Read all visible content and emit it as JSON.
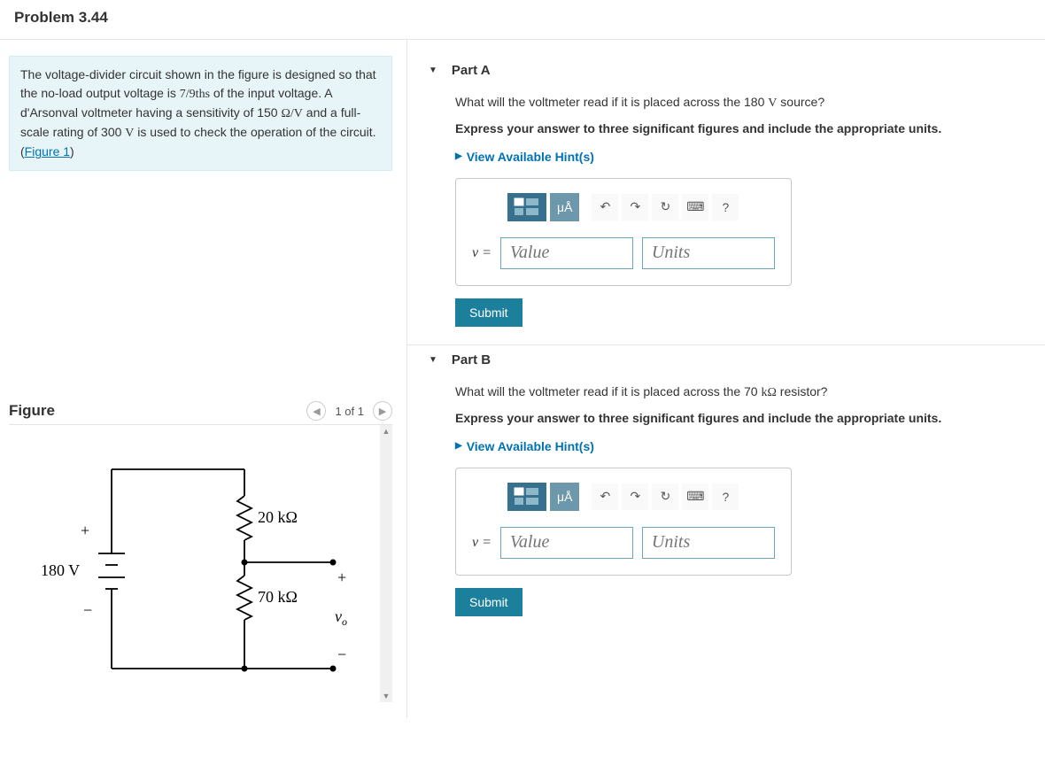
{
  "problem": {
    "title": "Problem 3.44",
    "intro_html": "The voltage-divider circuit shown in the figure is designed so that the no-load output voltage is <span class='math'>7/9ths</span> of the input voltage. A d'Arsonval voltmeter having a sensitivity of 150 <span class='math'>Ω/V</span> and a full-scale rating of 300 <span class='math'>V</span> is used to check the operation of the circuit. (<a href='#' data-name='figure-link' data-interactable='true'>Figure 1</a>)"
  },
  "figure": {
    "title": "Figure",
    "pager_text": "1 of 1",
    "source_voltage": "180 V",
    "r1": "20 kΩ",
    "r2": "70 kΩ",
    "vo": "v_o"
  },
  "parts": [
    {
      "title": "Part A",
      "question_html": "What will the voltmeter read if it is placed across the 180 <span class='math'>V</span> source?",
      "instruction": "Express your answer to three significant figures and include the appropriate units.",
      "hints_label": "View Available Hint(s)",
      "lhs": "v =",
      "value_placeholder": "Value",
      "units_placeholder": "Units",
      "units_btn": "μÅ",
      "submit": "Submit"
    },
    {
      "title": "Part B",
      "question_html": "What will the voltmeter read if it is placed across the 70 <span class='math'>kΩ</span> resistor?",
      "instruction": "Express your answer to three significant figures and include the appropriate units.",
      "hints_label": "View Available Hint(s)",
      "lhs": "v =",
      "value_placeholder": "Value",
      "units_placeholder": "Units",
      "units_btn": "μÅ",
      "submit": "Submit"
    }
  ]
}
